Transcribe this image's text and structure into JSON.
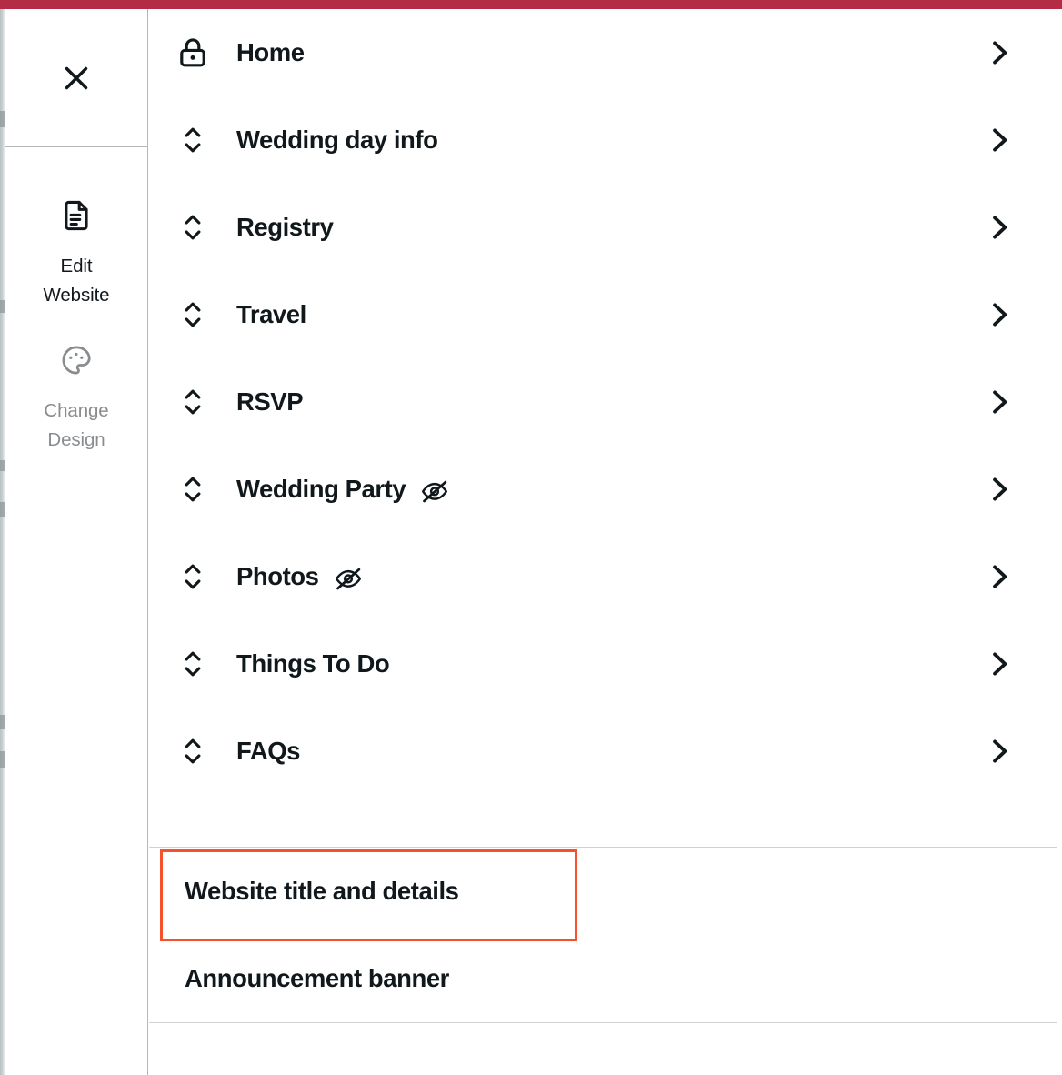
{
  "theme": {
    "top_bar_color": "#B32B45",
    "accent_highlight_color": "#F4512C",
    "text_color": "#11181C",
    "muted_text_color": "#898D90",
    "divider_color": "#CFD2D4"
  },
  "top_bar": {
    "label": ""
  },
  "rail": {
    "close_label": "Close",
    "items": [
      {
        "label": "Edit\nWebsite",
        "line1": "Edit",
        "line2": "Website",
        "icon": "document-icon",
        "state": "active"
      },
      {
        "label": "Change\nDesign",
        "line1": "Change",
        "line2": "Design",
        "icon": "palette-icon",
        "state": "inactive"
      }
    ]
  },
  "panel": {
    "nav_items": [
      {
        "label": "Home",
        "lead_icon": "lock-icon",
        "hidden": false,
        "chevron": "chevron-right-icon"
      },
      {
        "label": "Wedding day info",
        "lead_icon": "reorder-handle-icon",
        "hidden": false,
        "chevron": "chevron-right-icon"
      },
      {
        "label": "Registry",
        "lead_icon": "reorder-handle-icon",
        "hidden": false,
        "chevron": "chevron-right-icon"
      },
      {
        "label": "Travel",
        "lead_icon": "reorder-handle-icon",
        "hidden": false,
        "chevron": "chevron-right-icon"
      },
      {
        "label": "RSVP",
        "lead_icon": "reorder-handle-icon",
        "hidden": false,
        "chevron": "chevron-right-icon"
      },
      {
        "label": "Wedding Party",
        "lead_icon": "reorder-handle-icon",
        "hidden": true,
        "chevron": "chevron-right-icon"
      },
      {
        "label": "Photos",
        "lead_icon": "reorder-handle-icon",
        "hidden": true,
        "chevron": "chevron-right-icon"
      },
      {
        "label": "Things To Do",
        "lead_icon": "reorder-handle-icon",
        "hidden": false,
        "chevron": "chevron-right-icon"
      },
      {
        "label": "FAQs",
        "lead_icon": "reorder-handle-icon",
        "hidden": false,
        "chevron": "chevron-right-icon"
      }
    ],
    "settings_items": [
      {
        "label": "Website title and details",
        "highlighted": true
      },
      {
        "label": "Announcement banner",
        "highlighted": false
      }
    ]
  }
}
